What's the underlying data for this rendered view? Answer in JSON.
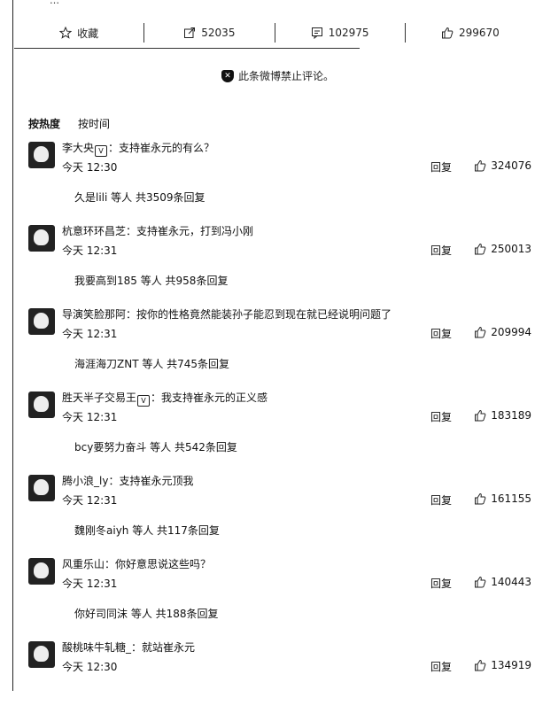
{
  "top_snippet": {
    "text": "…",
    "highlight": ""
  },
  "actions": [
    {
      "icon": "star-icon",
      "label": "收藏"
    },
    {
      "icon": "share-icon",
      "label": "52035"
    },
    {
      "icon": "comment-icon",
      "label": "102975"
    },
    {
      "icon": "thumbs-up-icon",
      "label": "299670"
    }
  ],
  "notice": "此条微博禁止评论。",
  "sort": {
    "by_hot": "按热度",
    "by_time": "按时间"
  },
  "comments": [
    {
      "user": "李大央",
      "text": "：支持崔永元的有么？",
      "time": "今天 12:30",
      "reply": "回复",
      "likes": "324076",
      "subreply": "久是lili 等人 共3509条回复"
    },
    {
      "user": "杭意环环昌芝",
      "text": "：支持崔永元，打到冯小刚",
      "time": "今天 12:31",
      "reply": "回复",
      "likes": "250013",
      "subreply": "我要高到185 等人 共958条回复"
    },
    {
      "user": "导演笑脸那阿",
      "text": "：按你的性格竟然能装孙子能忍到现在就已经说明问题了",
      "time": "今天 12:31",
      "reply": "回复",
      "likes": "209994",
      "subreply": "海涯海刀ZNT 等人 共745条回复"
    },
    {
      "user": "胜天半子交易王",
      "text": "：我支持崔永元的正义感",
      "time": "今天 12:31",
      "reply": "回复",
      "likes": "183189",
      "subreply": "bcy要努力奋斗 等人 共542条回复"
    },
    {
      "user": "腾小浪_ly",
      "text": "：支持崔永元顶我",
      "time": "今天 12:31",
      "reply": "回复",
      "likes": "161155",
      "subreply": "魏刚冬aiyh 等人 共117条回复"
    },
    {
      "user": "风重乐山",
      "text": "：你好意思说这些吗？",
      "time": "今天 12:31",
      "reply": "回复",
      "likes": "140443",
      "subreply": "你好司同沫 等人 共188条回复"
    },
    {
      "user": "酸桃味牛轧糖_",
      "text": "：就站崔永元",
      "time": "今天 12:30",
      "reply": "回复",
      "likes": "134919",
      "subreply": ""
    }
  ]
}
